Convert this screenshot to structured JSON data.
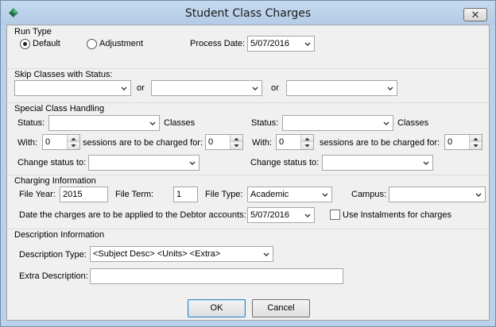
{
  "window": {
    "title": "Student Class Charges"
  },
  "run_type": {
    "heading": "Run Type",
    "default_label": "Default",
    "adjustment_label": "Adjustment",
    "selected": "Default",
    "process_date_label": "Process Date:",
    "process_date_value": "5/07/2016"
  },
  "skip_classes": {
    "heading": "Skip Classes with Status:",
    "or_label_1": "or",
    "or_label_2": "or",
    "status_1": "",
    "status_2": "",
    "status_3": ""
  },
  "special_handling": {
    "heading": "Special Class Handling",
    "left": {
      "status_label": "Status:",
      "status_value": "",
      "classes_label": "Classes",
      "with_label": "With:",
      "with_value": "0",
      "sessions_label": "sessions are to be charged for:",
      "charged_value": "0",
      "change_status_label": "Change status to:",
      "change_status_value": ""
    },
    "right": {
      "status_label": "Status:",
      "status_value": "",
      "classes_label": "Classes",
      "with_label": "With:",
      "with_value": "0",
      "sessions_label": "sessions are to be charged for:",
      "charged_value": "0",
      "change_status_label": "Change status to:",
      "change_status_value": ""
    }
  },
  "charging": {
    "heading": "Charging Information",
    "file_year_label": "File Year:",
    "file_year_value": "2015",
    "file_term_label": "File Term:",
    "file_term_value": "1",
    "file_type_label": "File Type:",
    "file_type_value": "Academic",
    "campus_label": "Campus:",
    "campus_value": "",
    "date_applied_label": "Date the charges are to be applied to the Debtor accounts:",
    "date_applied_value": "5/07/2016",
    "instalments_label": "Use Instalments for charges",
    "instalments_checked": false
  },
  "description": {
    "heading": "Description Information",
    "type_label": "Description Type:",
    "type_value": "<Subject Desc> <Units> <Extra>",
    "extra_label": "Extra Description:",
    "extra_value": ""
  },
  "buttons": {
    "ok_label": "OK",
    "cancel_label": "Cancel"
  }
}
